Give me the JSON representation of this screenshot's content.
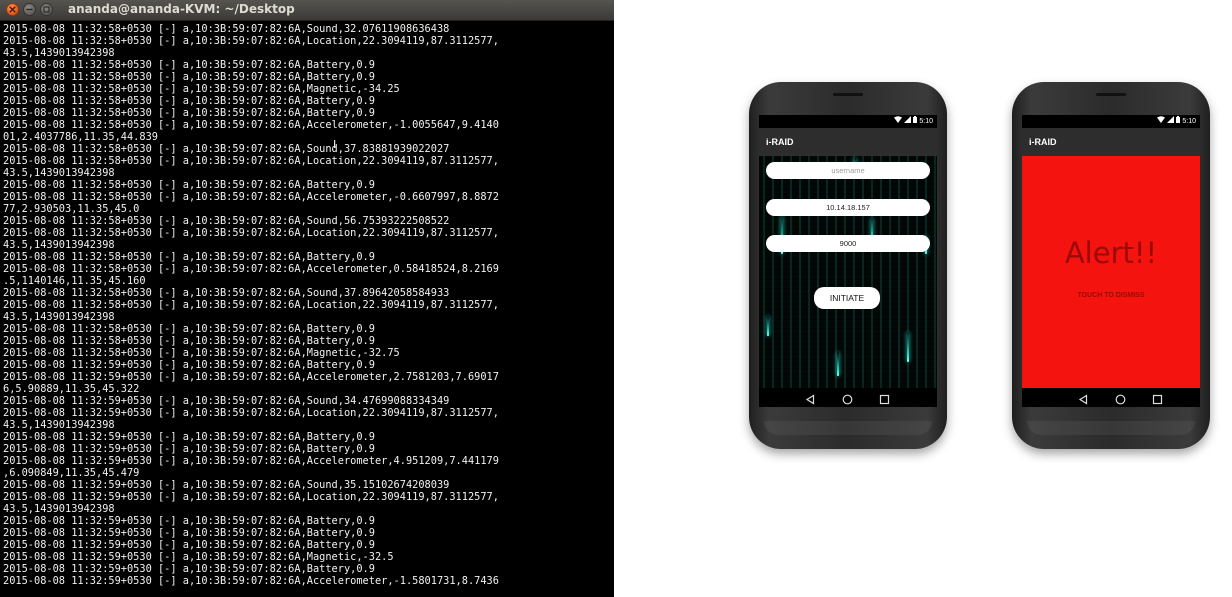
{
  "terminal": {
    "title": "ananda@ananda-KVM: ~/Desktop",
    "lines": [
      "2015-08-08 11:32:58+0530 [-] a,10:3B:59:07:82:6A,Sound,32.07611908636438",
      "2015-08-08 11:32:58+0530 [-] a,10:3B:59:07:82:6A,Location,22.3094119,87.3112577,",
      "43.5,1439013942398",
      "2015-08-08 11:32:58+0530 [-] a,10:3B:59:07:82:6A,Battery,0.9",
      "2015-08-08 11:32:58+0530 [-] a,10:3B:59:07:82:6A,Battery,0.9",
      "2015-08-08 11:32:58+0530 [-] a,10:3B:59:07:82:6A,Magnetic,-34.25",
      "2015-08-08 11:32:58+0530 [-] a,10:3B:59:07:82:6A,Battery,0.9",
      "2015-08-08 11:32:58+0530 [-] a,10:3B:59:07:82:6A,Battery,0.9",
      "2015-08-08 11:32:58+0530 [-] a,10:3B:59:07:82:6A,Accelerometer,-1.0055647,9.4140",
      "01,2.4037786,11.35,44.839",
      "2015-08-08 11:32:58+0530 [-] a,10:3B:59:07:82:6A,Sound,37.83881939022027",
      "2015-08-08 11:32:58+0530 [-] a,10:3B:59:07:82:6A,Location,22.3094119,87.3112577,",
      "43.5,1439013942398",
      "2015-08-08 11:32:58+0530 [-] a,10:3B:59:07:82:6A,Battery,0.9",
      "2015-08-08 11:32:58+0530 [-] a,10:3B:59:07:82:6A,Accelerometer,-0.6607997,8.8872",
      "77,2.930503,11.35,45.0",
      "2015-08-08 11:32:58+0530 [-] a,10:3B:59:07:82:6A,Sound,56.75393222508522",
      "2015-08-08 11:32:58+0530 [-] a,10:3B:59:07:82:6A,Location,22.3094119,87.3112577,",
      "43.5,1439013942398",
      "2015-08-08 11:32:58+0530 [-] a,10:3B:59:07:82:6A,Battery,0.9",
      "2015-08-08 11:32:58+0530 [-] a,10:3B:59:07:82:6A,Accelerometer,0.58418524,8.2169",
      ".5,1140146,11.35,45.160",
      "2015-08-08 11:32:58+0530 [-] a,10:3B:59:07:82:6A,Sound,37.89642058584933",
      "2015-08-08 11:32:58+0530 [-] a,10:3B:59:07:82:6A,Location,22.3094119,87.3112577,",
      "43.5,1439013942398",
      "2015-08-08 11:32:58+0530 [-] a,10:3B:59:07:82:6A,Battery,0.9",
      "2015-08-08 11:32:58+0530 [-] a,10:3B:59:07:82:6A,Battery,0.9",
      "2015-08-08 11:32:58+0530 [-] a,10:3B:59:07:82:6A,Magnetic,-32.75",
      "2015-08-08 11:32:59+0530 [-] a,10:3B:59:07:82:6A,Battery,0.9",
      "2015-08-08 11:32:59+0530 [-] a,10:3B:59:07:82:6A,Accelerometer,2.7581203,7.69017",
      "6,5.90889,11.35,45.322",
      "2015-08-08 11:32:59+0530 [-] a,10:3B:59:07:82:6A,Sound,34.47699088334349",
      "2015-08-08 11:32:59+0530 [-] a,10:3B:59:07:82:6A,Location,22.3094119,87.3112577,",
      "43.5,1439013942398",
      "2015-08-08 11:32:59+0530 [-] a,10:3B:59:07:82:6A,Battery,0.9",
      "2015-08-08 11:32:59+0530 [-] a,10:3B:59:07:82:6A,Battery,0.9",
      "2015-08-08 11:32:59+0530 [-] a,10:3B:59:07:82:6A,Accelerometer,4.951209,7.441179",
      ",6.090849,11.35,45.479",
      "2015-08-08 11:32:59+0530 [-] a,10:3B:59:07:82:6A,Sound,35.15102674208039",
      "2015-08-08 11:32:59+0530 [-] a,10:3B:59:07:82:6A,Location,22.3094119,87.3112577,",
      "43.5,1439013942398",
      "2015-08-08 11:32:59+0530 [-] a,10:3B:59:07:82:6A,Battery,0.9",
      "2015-08-08 11:32:59+0530 [-] a,10:3B:59:07:82:6A,Battery,0.9",
      "2015-08-08 11:32:59+0530 [-] a,10:3B:59:07:82:6A,Battery,0.9",
      "2015-08-08 11:32:59+0530 [-] a,10:3B:59:07:82:6A,Magnetic,-32.5",
      "2015-08-08 11:32:59+0530 [-] a,10:3B:59:07:82:6A,Battery,0.9",
      "2015-08-08 11:32:59+0530 [-] a,10:3B:59:07:82:6A,Accelerometer,-1.5801731,8.7436"
    ],
    "cursor_glyph": "I"
  },
  "phone_login": {
    "status_time": "5:10",
    "app_title": "i-RAID",
    "username_placeholder": "username",
    "ip_value": "10.14.18.157",
    "port_value": "9000",
    "initiate_label": "INITIATE"
  },
  "phone_alert": {
    "status_time": "5:10",
    "app_title": "i-RAID",
    "alert_title": "Alert!!",
    "alert_subtitle": "TOUCH TO DISMISS",
    "alert_color": "#f4130e"
  }
}
